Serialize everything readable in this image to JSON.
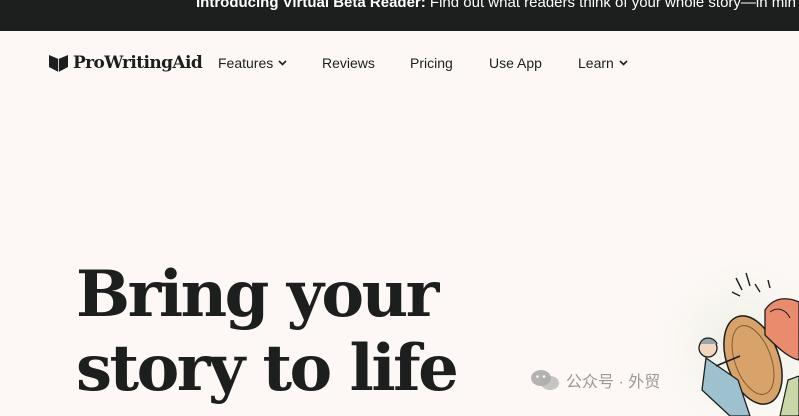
{
  "announcement": {
    "title": "Introducing Virtual Beta Reader",
    "text": " Find out what readers think of your whole story—in min"
  },
  "brand": {
    "name": "ProWritingAid",
    "logo_icon": "book-heart-logo-icon",
    "dark_color": "#1c1f1e",
    "background_color": "#fdf8f5"
  },
  "nav": {
    "features": "Features",
    "reviews": "Reviews",
    "pricing": "Pricing",
    "use_app": "Use App",
    "learn": "Learn"
  },
  "hero": {
    "line1": "Bring your",
    "line2": "story to life"
  },
  "watermark": {
    "text": "公众号 · 外贸",
    "icon": "wechat-icon"
  }
}
